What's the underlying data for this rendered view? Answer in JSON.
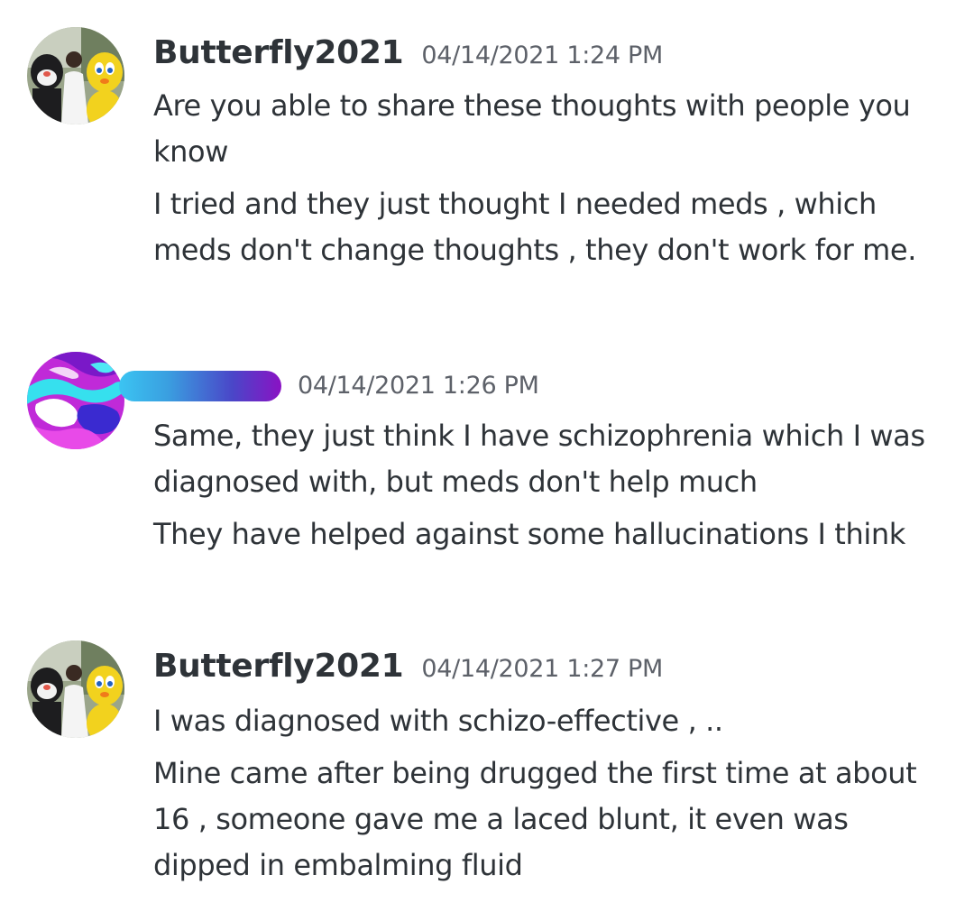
{
  "messages": [
    {
      "username": "Butterfly2021",
      "timestamp": "04/14/2021 1:24 PM",
      "avatar_icon": "user-photo-avatar",
      "lines": [
        "Are you able to share these thoughts with people you know",
        "I tried and they just thought I needed meds , which meds don't change thoughts , they don't work for me."
      ]
    },
    {
      "username": "",
      "timestamp": "04/14/2021 1:26 PM",
      "avatar_icon": "abstract-swirl-avatar",
      "username_redacted": true,
      "lines": [
        "Same, they just think I have schizophrenia which I was diagnosed with, but meds don't help much",
        "They have helped against some hallucinations I think"
      ]
    },
    {
      "username": "Butterfly2021",
      "timestamp": "04/14/2021 1:27 PM",
      "avatar_icon": "user-photo-avatar",
      "lines": [
        "I was diagnosed with schizo-effective , ..",
        "Mine came after being drugged the first time at about 16 , someone gave me a laced blunt, it even was dipped in embalming fluid"
      ]
    }
  ],
  "colors": {
    "text": "#2e3338",
    "timestamp": "#5d6169",
    "background": "#ffffff",
    "redaction_gradient_start": "#3bc4f2",
    "redaction_gradient_end": "#8a12c4"
  }
}
